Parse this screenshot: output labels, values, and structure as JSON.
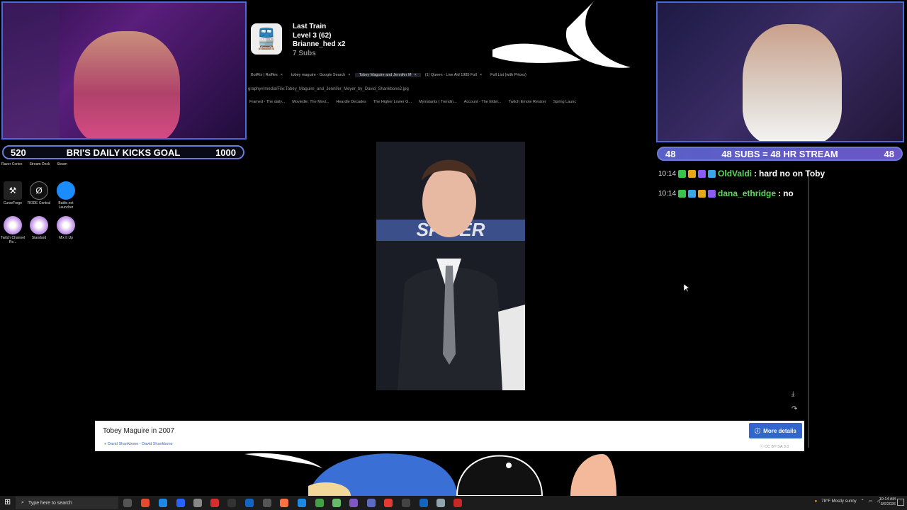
{
  "train": {
    "title": "Last Train",
    "level": "Level 3  (62)",
    "user": "Brianne_hed x2",
    "subs": "7 Subs"
  },
  "browser": {
    "tabs": [
      {
        "label": "BotRix | Raffles",
        "active": false
      },
      {
        "label": "tobey maguire - Google Search",
        "active": false
      },
      {
        "label": "Tobey Maguire and Jennifer M",
        "active": true
      },
      {
        "label": "(1) Queen - Live Aid 1985 Full",
        "active": false
      },
      {
        "label": "Full List (with Prices)",
        "active": false
      }
    ],
    "address": "graphy#/media/File:Tobey_Maguire_and_Jennifer_Meyer_by_David_Shankbone2.jpg",
    "bookmarks": [
      "Framed - The daily...",
      "Moviedle: The Movi...",
      "Heardle Decades",
      "The Higher Lower G...",
      "Myinstants | Trendin...",
      "Account - The Elder...",
      "Twitch Emote Resizer",
      "Spring Launc"
    ]
  },
  "left_goal": {
    "current": "520",
    "label": "BRI'S DAILY KICKS GOAL",
    "target": "1000"
  },
  "right_goal": {
    "left": "48",
    "label": "48 SUBS = 48 HR STREAM",
    "right": "48"
  },
  "desktop": {
    "labels_top": [
      "Razer Cortex",
      "Stream Deck",
      "Steam"
    ],
    "icons": [
      {
        "name": "CurseForge",
        "icon": "curseforge-icon"
      },
      {
        "name": "RODE Central",
        "icon": "rode-icon"
      },
      {
        "name": "Battle.net Launcher",
        "icon": "battlenet-icon"
      },
      {
        "name": "Twitch Channel Re...",
        "icon": "twitch-icon"
      },
      {
        "name": "Standard",
        "icon": "twitch-icon"
      },
      {
        "name": "Mix It Up",
        "icon": "twitch-icon"
      }
    ]
  },
  "chat": [
    {
      "time": "10:14",
      "user": "OldValdi",
      "message": "hard no on Toby"
    },
    {
      "time": "10:14",
      "user": "dana_ethridge",
      "message": "no"
    }
  ],
  "media": {
    "caption": "Tobey Maguire in 2007",
    "author": "David Shankbone - David Shankbone",
    "more_details": "More details",
    "license": "CC BY-SA 3.0"
  },
  "taskbar": {
    "search_placeholder": "Type here to search",
    "weather": "78°F  Mostly sunny",
    "time": "10:14 AM",
    "date": "3/6/2026"
  },
  "colors": {
    "goal_border": "#6c7cd9",
    "chat_user": "#5cd95c",
    "link": "#3366cc"
  }
}
